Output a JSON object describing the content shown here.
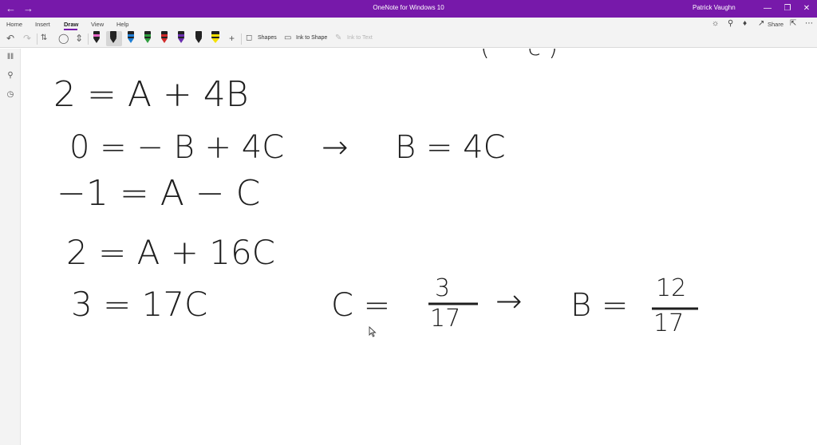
{
  "titlebar": {
    "app_title": "OneNote for Windows 10",
    "user_name": "Patrick Vaughn",
    "back_icon": "arrow-left-icon",
    "forward_icon": "arrow-right-icon",
    "window_buttons": [
      "minimize-icon",
      "restore-icon",
      "close-icon"
    ],
    "color": "#7719aa"
  },
  "menu": {
    "items": [
      "Home",
      "Insert",
      "Draw",
      "View",
      "Help"
    ],
    "active": "Draw",
    "share_label": "Share"
  },
  "ribbon": {
    "shapes_label": "Shapes",
    "ink_to_shape_label": "Ink to Shape",
    "ink_to_text_label": "Ink to Text",
    "pens": [
      {
        "name": "pen-black-pink",
        "color": "#e868c8"
      },
      {
        "name": "pen-black-selected",
        "color": "#222222"
      },
      {
        "name": "pen-blue",
        "color": "#1e7fd6"
      },
      {
        "name": "pen-green",
        "color": "#2e9e3e"
      },
      {
        "name": "pen-red",
        "color": "#d12a2a"
      },
      {
        "name": "pen-purple",
        "color": "#6b2fb0"
      },
      {
        "name": "pen-black",
        "color": "#222222"
      },
      {
        "name": "highlighter-yellow",
        "color": "#f5e100"
      }
    ]
  },
  "ink": {
    "partial_top": "( · · c )",
    "line1": "2 = A + 4B",
    "line2": "0 = − B + 4C",
    "line2_arrow": "→",
    "line2_result": "B = 4C",
    "line3": "−1 = A − C",
    "line4": "2 = A + 16C",
    "line5": "3 = 17C",
    "c_eq": "C =",
    "c_num": "3",
    "c_den": "17",
    "arrow2": "→",
    "b_eq": "B =",
    "b_num": "12",
    "b_den": "17"
  }
}
